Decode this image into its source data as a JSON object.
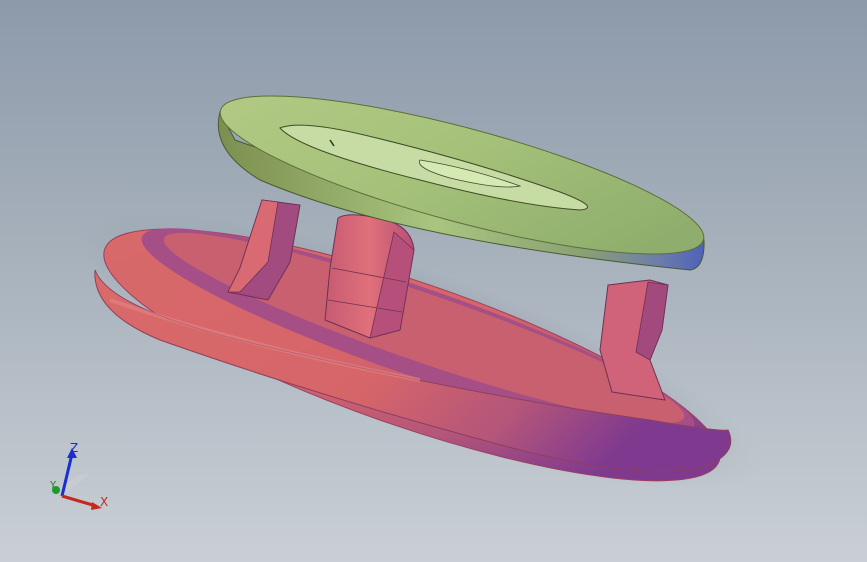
{
  "viewport": {
    "background_top": "#8d9aaa",
    "background_bottom": "#c9cfd5"
  },
  "model": {
    "ring_color": "#d76a6a",
    "ring_shade_color": "#8e3f8e",
    "disc_color": "#a8c47a",
    "disc_shade_color": "#5c73b8"
  },
  "triad": {
    "z_label": "Z",
    "x_label": "X",
    "y_label": "Y",
    "z_color": "#1a2ed1",
    "x_color": "#c32a1f",
    "y_color": "#1f7a1f"
  }
}
